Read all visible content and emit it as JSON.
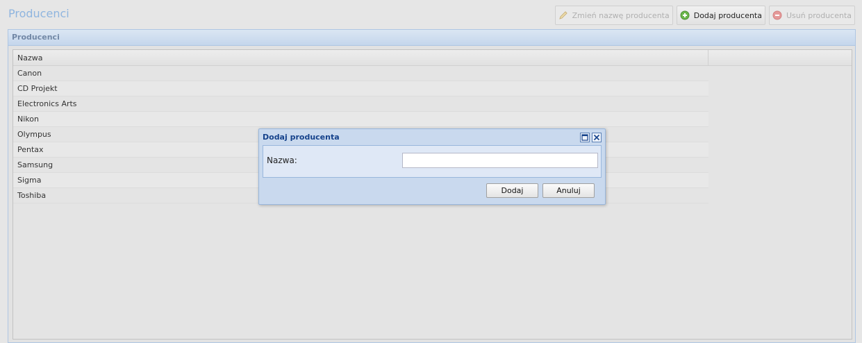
{
  "page": {
    "title": "Producenci"
  },
  "toolbar": {
    "rename_label": "Zmień nazwę producenta",
    "add_label": "Dodaj producenta",
    "delete_label": "Usuń producenta"
  },
  "panel": {
    "title": "Producenci"
  },
  "grid": {
    "column_name": "Nazwa",
    "rows": [
      "Canon",
      "CD Projekt",
      "Electronics Arts",
      "Nikon",
      "Olympus",
      "Pentax",
      "Samsung",
      "Sigma",
      "Toshiba"
    ]
  },
  "dialog": {
    "title": "Dodaj producenta",
    "field_label": "Nazwa:",
    "field_value": "",
    "ok_label": "Dodaj",
    "cancel_label": "Anuluj"
  },
  "colors": {
    "title_accent": "#8fb5df",
    "dialog_title": "#15428b",
    "add_icon": "#6bb64b",
    "delete_icon": "#e59a9a"
  }
}
